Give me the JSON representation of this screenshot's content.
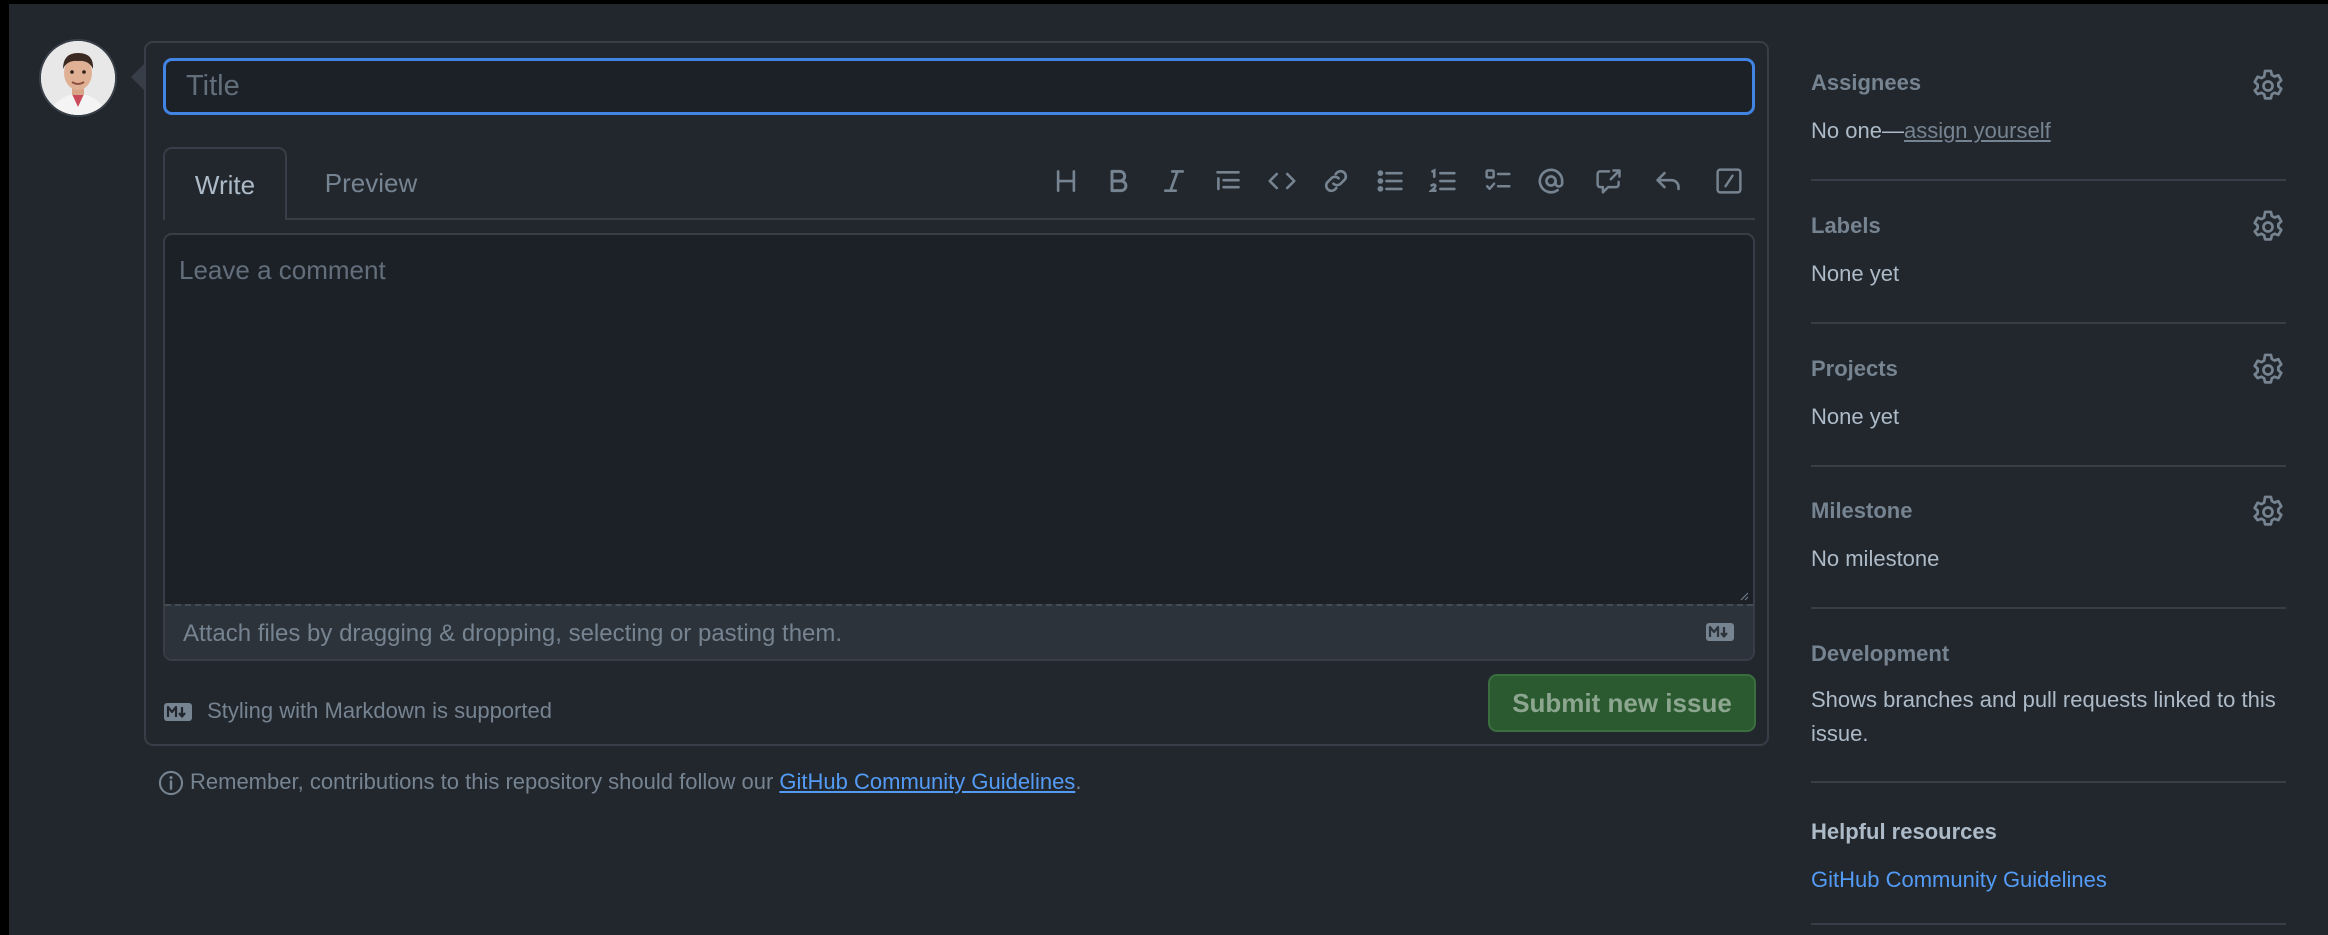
{
  "form": {
    "title_placeholder": "Title",
    "tabs": {
      "write": "Write",
      "preview": "Preview"
    },
    "comment_placeholder": "Leave a comment",
    "attach_text": "Attach files by dragging & dropping, selecting or pasting them.",
    "markdown_note": "Styling with Markdown is supported",
    "submit_label": "Submit new issue"
  },
  "guideline": {
    "prefix": "Remember, contributions to this repository should follow our ",
    "link_text": "GitHub Community Guidelines",
    "suffix": "."
  },
  "toolbar_icons": [
    "heading-icon",
    "bold-icon",
    "italic-icon",
    "quote-icon",
    "code-icon",
    "link-icon",
    "bulleted-list-icon",
    "numbered-list-icon",
    "task-list-icon",
    "mention-icon",
    "cross-reference-icon",
    "reply-icon",
    "slash-command-icon"
  ],
  "sidebar": {
    "assignees": {
      "heading": "Assignees",
      "value_prefix": "No one—",
      "value_link": "assign yourself"
    },
    "labels": {
      "heading": "Labels",
      "value": "None yet"
    },
    "projects": {
      "heading": "Projects",
      "value": "None yet"
    },
    "milestone": {
      "heading": "Milestone",
      "value": "No milestone"
    },
    "development": {
      "heading": "Development",
      "value": "Shows branches and pull requests linked to this issue."
    },
    "helpful": {
      "heading": "Helpful resources",
      "link": "GitHub Community Guidelines"
    }
  },
  "colors": {
    "background": "#22272e",
    "accent_blue": "#4184e4",
    "link_blue": "#539bf5",
    "submit_green": "#2b5a30"
  }
}
